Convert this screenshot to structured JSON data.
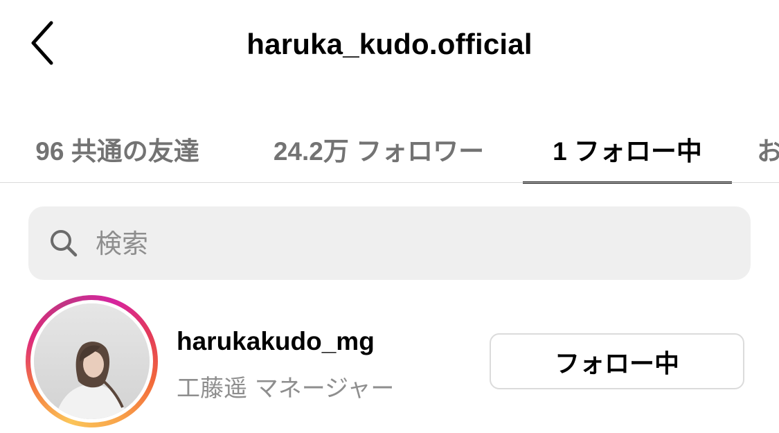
{
  "header": {
    "title": "haruka_kudo.official",
    "back_icon": "chevron-left-icon"
  },
  "tabs": [
    {
      "label": "96 共通の友達",
      "active": false
    },
    {
      "label": "24.2万 フォロワー",
      "active": false
    },
    {
      "label": "1 フォロー中",
      "active": true
    },
    {
      "label": "お",
      "active": false
    }
  ],
  "search": {
    "placeholder": "検索",
    "value": "",
    "icon": "search-icon"
  },
  "following_list": [
    {
      "username": "harukakudo_mg",
      "full_name": "工藤遥 マネージャー",
      "button_label": "フォロー中",
      "has_story_ring": true
    }
  ],
  "colors": {
    "text_primary": "#000000",
    "text_secondary": "#8e8e8e",
    "tab_inactive": "#737373",
    "divider": "#dbdbdb",
    "search_bg": "#efefef",
    "story_ring": [
      "#d6249f",
      "#f26b3a",
      "#fbc55a"
    ]
  }
}
